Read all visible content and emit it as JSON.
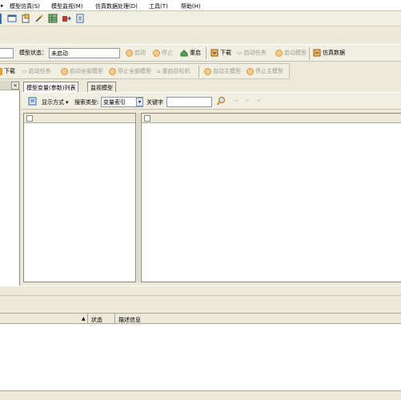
{
  "menu": [
    "模型仿真(S)",
    "模型监视(M)",
    "仿真数据处理(D)",
    "工具(T)",
    "帮助(H)"
  ],
  "toolbar_icons": [
    "layout-icon",
    "open-icon",
    "wand-icon",
    "grid-icon",
    "export-icon",
    "doc-icon"
  ],
  "model_status": {
    "label": "模型状态：",
    "value": "未启动"
  },
  "toolbar2": {
    "start": "启动",
    "stop": "停止",
    "restart": "重启",
    "download": "下载",
    "start_task": "启动任务",
    "start_model": "启动模型",
    "sim_data": "仿真数据"
  },
  "toolbar3": {
    "download": "下载",
    "start_task": "启动任务",
    "start_all_models": "启动全部模型",
    "stop_all_models": "停止全部模型",
    "restart_target": "重启目标机",
    "start_main_model": "启动主模型",
    "stop_main_model": "停止主模型"
  },
  "left_panel": {
    "close": "×"
  },
  "tabs": [
    "模型变量(参数)列表",
    "监视模型"
  ],
  "search": {
    "display_mode": "显示方式",
    "search_type_label": "搜索类型:",
    "search_type_value": "变量索引",
    "keyword_label": "关键字",
    "keyword_value": ""
  },
  "bottom_columns": {
    "status": "状态",
    "description": "描述信息"
  },
  "colors": {
    "accent_green": "#2e8b2e",
    "accent_orange": "#e08a2a",
    "accent_blue": "#3465a4"
  }
}
